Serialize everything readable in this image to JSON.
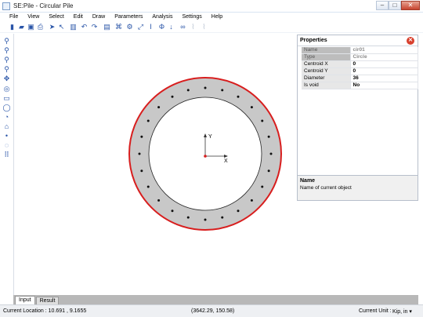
{
  "window": {
    "title": "SE:Pile - Circular Pile",
    "minimize": "–",
    "maximize": "□",
    "close": "✕"
  },
  "menu": [
    "File",
    "View",
    "Select",
    "Edit",
    "Draw",
    "Parameters",
    "Analysis",
    "Settings",
    "Help"
  ],
  "toolbar": [
    {
      "icon": "new-file-icon",
      "glyph": "▮"
    },
    {
      "icon": "open-folder-icon",
      "glyph": "▰"
    },
    {
      "icon": "save-icon",
      "glyph": "▣"
    },
    {
      "icon": "print-icon",
      "glyph": "⎙"
    },
    {
      "icon": "select-arrow-icon",
      "glyph": "➤"
    },
    {
      "icon": "select-node-icon",
      "glyph": "↖"
    },
    {
      "icon": "delete-icon",
      "glyph": "▥"
    },
    {
      "icon": "undo-icon",
      "glyph": "↶"
    },
    {
      "icon": "redo-icon",
      "glyph": "↷"
    },
    {
      "icon": "calculator-icon",
      "glyph": "▤"
    },
    {
      "icon": "hierarchy-icon",
      "glyph": "⌘"
    },
    {
      "icon": "rebar-icon",
      "glyph": "⚙"
    },
    {
      "icon": "dimension-icon",
      "glyph": "⤢"
    },
    {
      "icon": "vertical-dimension-icon",
      "glyph": "I"
    },
    {
      "icon": "phi-icon",
      "glyph": "Φ"
    },
    {
      "icon": "down-arrow-icon",
      "glyph": "↓"
    },
    {
      "icon": "link-icon",
      "glyph": "∞"
    },
    {
      "icon": "chart-icon",
      "glyph": "⌇"
    },
    {
      "icon": "curve-icon",
      "glyph": "⌇"
    }
  ],
  "lefttools": [
    "zoom-icon",
    "zoom-in-icon",
    "zoom-out-icon",
    "zoom-window-icon",
    "pan-icon",
    "circle-tool-icon",
    "rectangle-tool-icon",
    "ellipse-tool-icon",
    "arc-tool-icon",
    "polygon-tool-icon",
    "point-tool-icon",
    "circular-pattern-icon",
    "grid-pattern-icon"
  ],
  "properties": {
    "title": "Properties",
    "close": "✕",
    "rows": [
      {
        "key": "Name",
        "value": "cir01",
        "readonly": true
      },
      {
        "key": "Type",
        "value": "Circle",
        "readonly": true
      },
      {
        "key": "Centroid  X",
        "value": "0",
        "readonly": false
      },
      {
        "key": "Centroid  Y",
        "value": "0",
        "readonly": false
      },
      {
        "key": "Diameter",
        "value": "36",
        "readonly": false
      },
      {
        "key": "Is void",
        "value": "No",
        "readonly": false
      }
    ]
  },
  "help": {
    "title": "Name",
    "text": "Name of current object"
  },
  "axes": {
    "x": "X",
    "y": "Y"
  },
  "tabs": [
    {
      "label": "Input",
      "active": true
    },
    {
      "label": "Result",
      "active": false
    }
  ],
  "status": {
    "location": "Current Location :  10.691 , 9.1655",
    "coords": "(3642.29, 150.58)",
    "unit_label": "Current Unit :",
    "unit": "Kip, in ▾"
  },
  "section": {
    "rebar_count": 24
  },
  "colors": {
    "ring": "#c8c8c8",
    "outer_outline": "#d81e1e",
    "accent": "#2a55a8"
  }
}
